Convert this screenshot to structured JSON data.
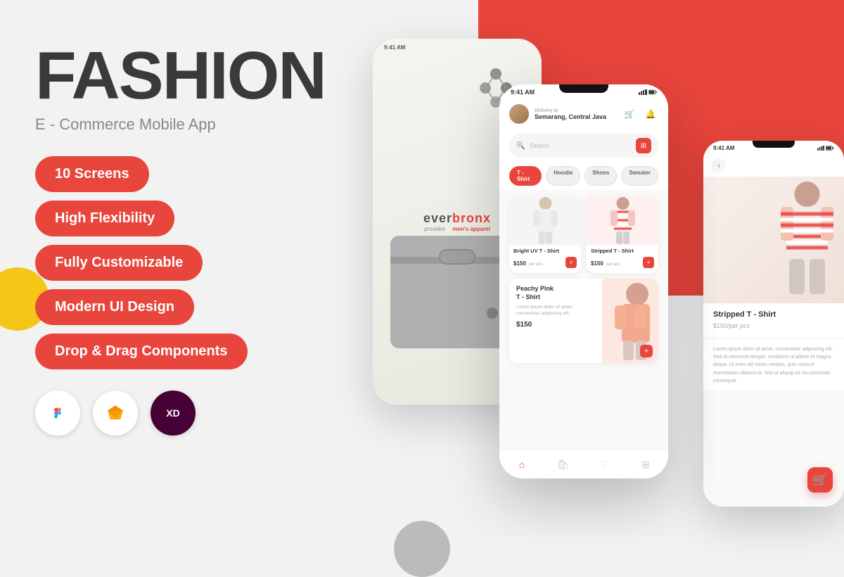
{
  "app": {
    "title": "FASHION",
    "subtitle": "E - Commerce Mobile App"
  },
  "features": [
    {
      "id": "screens",
      "label": "10 Screens"
    },
    {
      "id": "flexibility",
      "label": "High Flexibility"
    },
    {
      "id": "customizable",
      "label": "Fully Customizable"
    },
    {
      "id": "ui",
      "label": "Modern UI Design"
    },
    {
      "id": "drag",
      "label": "Drop & Drag Components"
    }
  ],
  "tools": [
    {
      "id": "figma",
      "label": "Figma"
    },
    {
      "id": "sketch",
      "label": "Sketch"
    },
    {
      "id": "xd",
      "label": "XD"
    }
  ],
  "phone_main": {
    "status_time": "9:41 AM",
    "delivery_label": "Delivery to",
    "delivery_location": "Semarang, Central Java",
    "search_placeholder": "Search",
    "categories": [
      "T - Shirt",
      "Hoodie",
      "Shoes",
      "Sweater"
    ],
    "active_category": "T - Shirt",
    "products": [
      {
        "id": "1",
        "name": "Bright UV T - Shirt",
        "price": "$150",
        "unit": "per pcs"
      },
      {
        "id": "2",
        "name": "Stripped T - Shirt",
        "price": "$150",
        "unit": "per pcs"
      },
      {
        "id": "3",
        "name": "Peachy Pink T - Shirt",
        "desc": "Lorem ipsum dolor sit amet, consectetur adipiscing elit.",
        "price": "$150"
      }
    ]
  },
  "phone_brand": {
    "status_time": "9:41 AM",
    "brand": "everbronx",
    "tagline1": "provides",
    "tagline2": "men's apparel"
  },
  "phone_detail": {
    "status_time": "9:41 AM",
    "product_name": "Stripped T - Shirt",
    "product_price": "$150",
    "price_unit": "/per pcs",
    "desc": "Lorem ipsum dolor sit amet, consectetur adipiscing elit. Sed do eiusmod tempor, incididunt ut labore et magna aliqua. Ut enim ad minim veniam, quis nostrud exercitation ullamco la. Nisi ut aliquip ex ea commodo consequat."
  },
  "colors": {
    "primary": "#e8453c",
    "dark_text": "#3a3a3a",
    "subtitle": "#888888",
    "bg": "#f2f2f2"
  }
}
